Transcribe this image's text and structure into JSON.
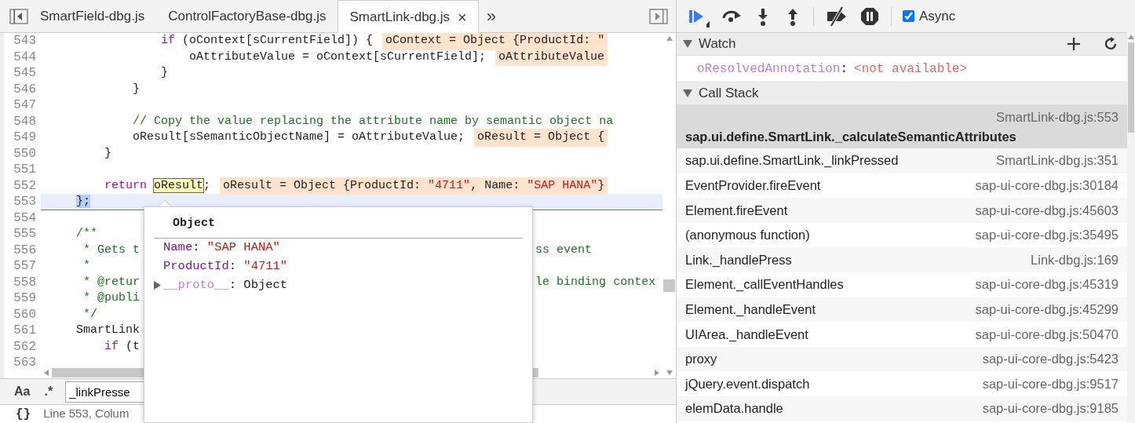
{
  "editor_tabs": [
    {
      "label": "SmartField-dbg.js",
      "selected": false
    },
    {
      "label": "ControlFactoryBase-dbg.js",
      "selected": false
    },
    {
      "label": "SmartLink-dbg.js",
      "selected": true,
      "close": "×"
    }
  ],
  "more_tabs": "»",
  "code_lines": [
    {
      "number": "543",
      "current": false,
      "segments": [
        {
          "kind": "keyword",
          "text": "                if"
        },
        {
          "kind": "plain",
          "text": " (oContext[sCurrentField]) {"
        }
      ],
      "inline_value": [
        {
          "kind": "plain",
          "text": "oContext = Object {ProductId: \""
        }
      ]
    },
    {
      "number": "544",
      "current": false,
      "segments": [
        {
          "kind": "plain",
          "text": "                    oAttributeValue = oContext[sCurrentField];"
        }
      ],
      "inline_value": [
        {
          "kind": "plain",
          "text": "oAttributeValue"
        }
      ]
    },
    {
      "number": "545",
      "current": false,
      "segments": [
        {
          "kind": "plain",
          "text": "                }"
        }
      ]
    },
    {
      "number": "546",
      "current": false,
      "segments": [
        {
          "kind": "plain",
          "text": "            }"
        }
      ]
    },
    {
      "number": "547",
      "current": false
    },
    {
      "number": "548",
      "current": false,
      "segments": [
        {
          "kind": "comment",
          "text": "            // Copy the value replacing the attribute name by semantic object na"
        }
      ]
    },
    {
      "number": "549",
      "current": false,
      "segments": [
        {
          "kind": "plain",
          "text": "            oResult[sSemanticObjectName] = oAttributeValue;"
        }
      ],
      "inline_value": [
        {
          "kind": "plain",
          "text": "oResult = Object {"
        }
      ]
    },
    {
      "number": "550",
      "current": false,
      "segments": [
        {
          "kind": "plain",
          "text": "        }"
        }
      ]
    },
    {
      "number": "551",
      "current": false
    },
    {
      "number": "552",
      "current": false,
      "segments": [
        {
          "kind": "keyword",
          "text": "        return "
        },
        {
          "kind": "hovered",
          "text": "oResult"
        },
        {
          "kind": "plain",
          "text": ";"
        }
      ],
      "inline_value": [
        {
          "kind": "plain",
          "text": "oResult = Object {ProductId: "
        },
        {
          "kind": "string",
          "text": "\"4711\""
        },
        {
          "kind": "plain",
          "text": ", Name: "
        },
        {
          "kind": "string",
          "text": "\"SAP HANA\""
        },
        {
          "kind": "plain",
          "text": "}"
        }
      ]
    },
    {
      "number": "553",
      "current": true,
      "segments": [
        {
          "kind": "selected",
          "text": "    };"
        }
      ]
    },
    {
      "number": "554",
      "current": false
    },
    {
      "number": "555",
      "current": false,
      "segments": [
        {
          "kind": "comment",
          "text": "    /**"
        }
      ]
    },
    {
      "number": "556",
      "current": false,
      "segments": [
        {
          "kind": "comment",
          "text": "     * Gets t"
        }
      ],
      "right": [
        {
          "kind": "comment",
          "text": "ss event"
        }
      ]
    },
    {
      "number": "557",
      "current": false,
      "segments": [
        {
          "kind": "comment",
          "text": "     *"
        }
      ]
    },
    {
      "number": "558",
      "current": false,
      "segments": [
        {
          "kind": "comment",
          "text": "     * @retur"
        }
      ],
      "right": [
        {
          "kind": "comment",
          "text": "le binding contex"
        }
      ]
    },
    {
      "number": "559",
      "current": false,
      "segments": [
        {
          "kind": "comment",
          "text": "     * @publi"
        }
      ]
    },
    {
      "number": "560",
      "current": false,
      "segments": [
        {
          "kind": "comment",
          "text": "     */"
        }
      ]
    },
    {
      "number": "561",
      "current": false,
      "segments": [
        {
          "kind": "plain",
          "text": "    SmartLink"
        }
      ]
    },
    {
      "number": "562",
      "current": false,
      "segments": [
        {
          "kind": "keyword",
          "text": "        if"
        },
        {
          "kind": "plain",
          "text": " (t"
        }
      ]
    },
    {
      "number": "563",
      "current": false
    }
  ],
  "popover": {
    "title": "Object",
    "properties": [
      {
        "name": "Name",
        "separator": ":",
        "value": "\"SAP HANA\"",
        "kind": "string",
        "expandable": false
      },
      {
        "name": "ProductId",
        "separator": ":",
        "value": "\"4711\"",
        "kind": "string",
        "expandable": false
      },
      {
        "name": "__proto__",
        "separator": ":",
        "value": "Object",
        "kind": "object",
        "expandable": true
      }
    ]
  },
  "search_bar": {
    "case_toggle": "Aa",
    "regex_toggle": ".*",
    "query": "_linkPresse"
  },
  "status_bar": {
    "format_button": "{}",
    "text": "Line 553, Colum"
  },
  "debugger_toolbar": {
    "async": {
      "label": "Async",
      "checked": true
    }
  },
  "watch": {
    "title": "Watch",
    "expanded": true,
    "items": [
      {
        "name": "oResolvedAnnotation",
        "separator": ":",
        "value": "<not available>"
      }
    ]
  },
  "call_stack": {
    "title": "Call Stack",
    "expanded": true,
    "frames": [
      {
        "function": "sap.ui.define.SmartLink._calculateSemanticAttributes",
        "location": "SmartLink-dbg.js:553",
        "selected": true
      },
      {
        "function": "sap.ui.define.SmartLink._linkPressed",
        "location": "SmartLink-dbg.js:351",
        "selected": false
      },
      {
        "function": "EventProvider.fireEvent",
        "location": "sap-ui-core-dbg.js:30184",
        "selected": false
      },
      {
        "function": "Element.fireEvent",
        "location": "sap-ui-core-dbg.js:45603",
        "selected": false
      },
      {
        "function": "(anonymous function)",
        "location": "sap-ui-core-dbg.js:35495",
        "selected": false
      },
      {
        "function": "Link._handlePress",
        "location": "Link-dbg.js:169",
        "selected": false
      },
      {
        "function": "Element._callEventHandles",
        "location": "sap-ui-core-dbg.js:45319",
        "selected": false
      },
      {
        "function": "Element._handleEvent",
        "location": "sap-ui-core-dbg.js:45299",
        "selected": false
      },
      {
        "function": "UIArea._handleEvent",
        "location": "sap-ui-core-dbg.js:50470",
        "selected": false
      },
      {
        "function": "proxy",
        "location": "sap-ui-core-dbg.js:5423",
        "selected": false
      },
      {
        "function": "jQuery.event.dispatch",
        "location": "sap-ui-core-dbg.js:9517",
        "selected": false
      },
      {
        "function": "elemData.handle",
        "location": "sap-ui-core-dbg.js:9185",
        "selected": false
      }
    ]
  }
}
